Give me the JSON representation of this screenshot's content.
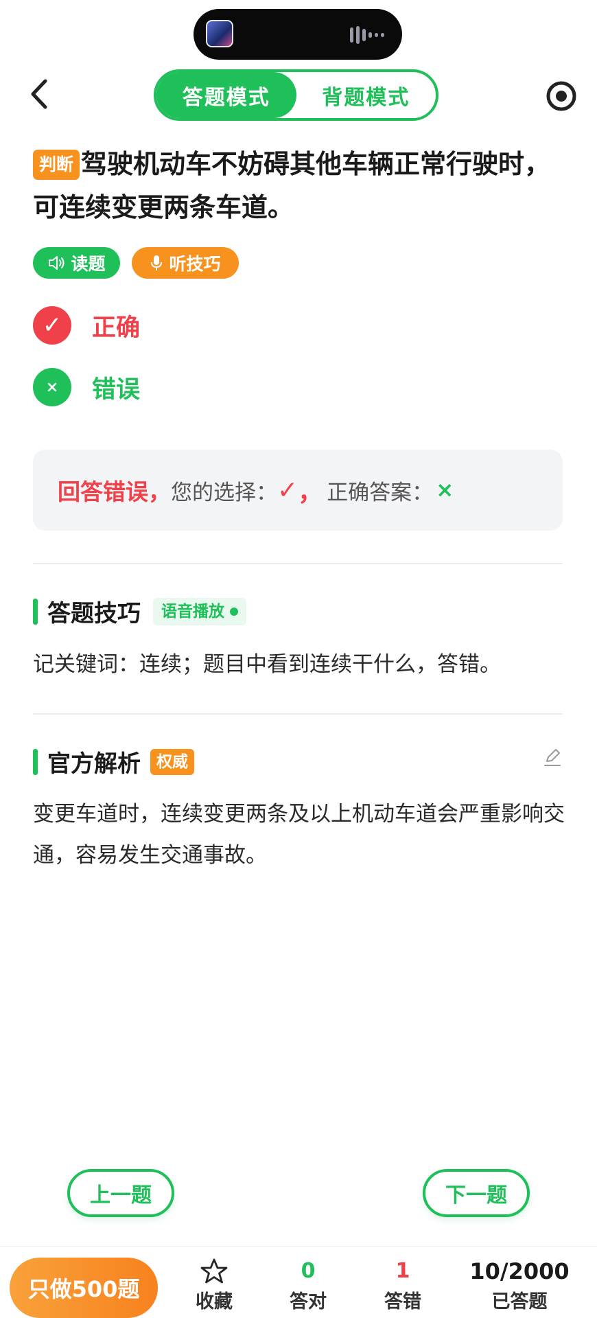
{
  "header": {
    "modes": [
      "答题模式",
      "背题模式"
    ],
    "active_mode": "背题模式"
  },
  "question": {
    "type_badge": "判断",
    "text": "驾驶机动车不妨碍其他车辆正常行驶时，可连续变更两条车道。",
    "read_button": "读题",
    "tip_button": "听技巧"
  },
  "options": [
    {
      "symbol": "✓",
      "label": "正确",
      "color": "#f0404a"
    },
    {
      "symbol": "×",
      "label": "错误",
      "color": "#1fbf5a"
    }
  ],
  "result": {
    "status": "回答错误，",
    "your_choice_label": "您的选择：",
    "your_choice": "✓",
    "separator": "，",
    "correct_label": "正确答案：",
    "correct_answer": "×"
  },
  "tips": {
    "title": "答题技巧",
    "voice_tag": "语音播放",
    "text": "记关键词：连续；题目中看到连续干什么，答错。"
  },
  "analysis": {
    "title": "官方解析",
    "badge": "权威",
    "text": "变更车道时，连续变更两条及以上机动车道会严重影响交通，容易发生交通事故。"
  },
  "navigation": {
    "prev": "上一题",
    "next": "下一题"
  },
  "bottom_bar": {
    "only500": "只做500题",
    "favorite": "收藏",
    "correct_count": "0",
    "correct_label": "答对",
    "wrong_count": "1",
    "wrong_label": "答错",
    "progress": "10/2000",
    "progress_label": "已答题"
  },
  "colors": {
    "green": "#1fbf5a",
    "orange": "#f7921e",
    "red": "#f0404a"
  }
}
